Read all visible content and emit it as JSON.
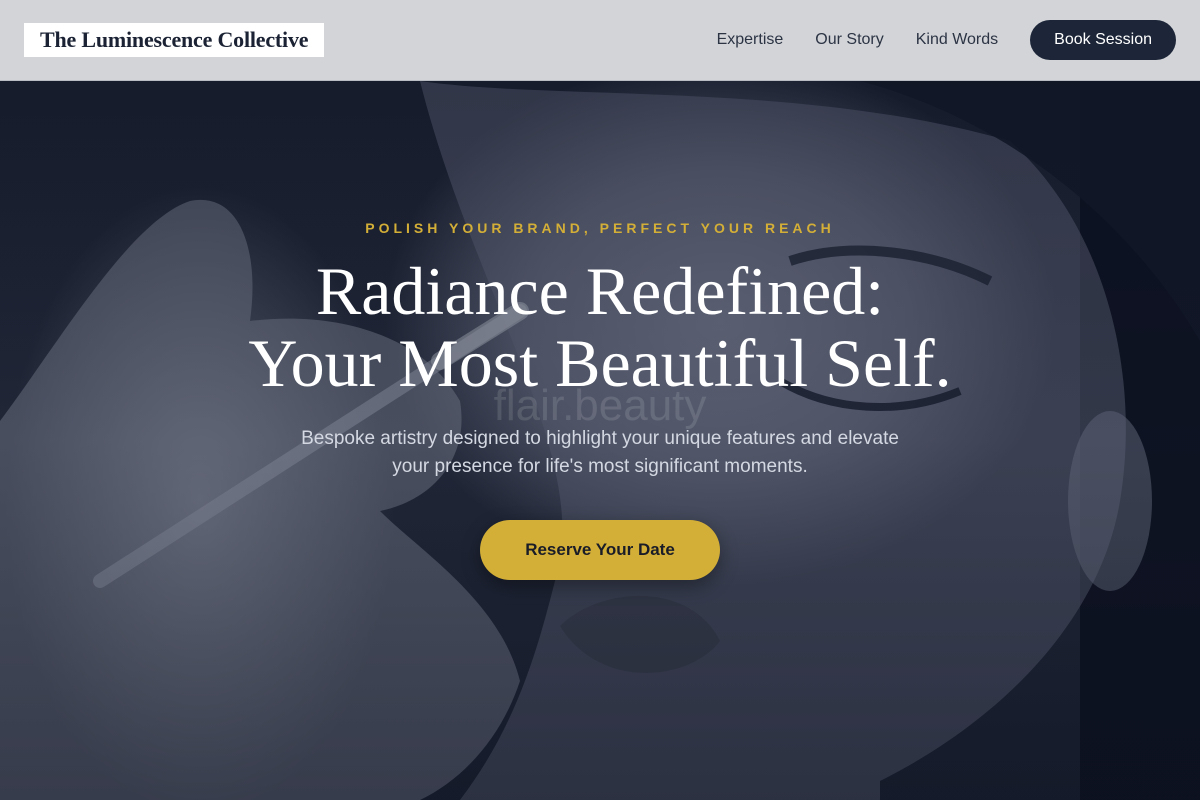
{
  "header": {
    "logo": "The Luminescence Collective",
    "nav": [
      {
        "label": "Expertise"
      },
      {
        "label": "Our Story"
      },
      {
        "label": "Kind Words"
      }
    ],
    "cta_label": "Book Session"
  },
  "hero": {
    "tagline": "POLISH YOUR BRAND, PERFECT YOUR REACH",
    "headline_line1": "Radiance Redefined:",
    "headline_line2": "Your Most Beautiful Self.",
    "watermark": "flair.beauty",
    "subtext": "Bespoke artistry designed to highlight your unique features and elevate your presence for life's most significant moments.",
    "cta_label": "Reserve Your Date"
  },
  "colors": {
    "accent": "#d4af37",
    "header_bg": "#d2d4d8",
    "button_dark": "#1c2638",
    "hero_bg": "#0b1020"
  }
}
